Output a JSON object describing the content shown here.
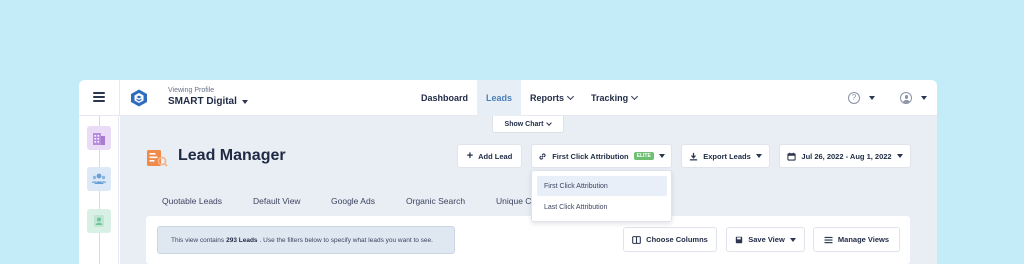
{
  "header": {
    "profile_label": "Viewing Profile",
    "profile_name": "SMART Digital",
    "nav": [
      {
        "label": "Dashboard",
        "active": false,
        "has_menu": false
      },
      {
        "label": "Leads",
        "active": true,
        "has_menu": false
      },
      {
        "label": "Reports",
        "active": false,
        "has_menu": true
      },
      {
        "label": "Tracking",
        "active": false,
        "has_menu": true
      }
    ],
    "help_glyph": "?"
  },
  "rail": {
    "items": [
      {
        "icon": "building-icon",
        "color": "#b98be0"
      },
      {
        "icon": "users-icon",
        "color": "#6a9fd8"
      },
      {
        "icon": "contact-card-icon",
        "color": "#6cc49a"
      }
    ]
  },
  "toolbar": {
    "show_chart": "Show Chart",
    "title": "Lead Manager",
    "add_lead": "Add Lead",
    "attribution": "First Click Attribution",
    "elite_badge": "ELITE",
    "export": "Export Leads",
    "date_range": "Jul 26, 2022 - Aug 1, 2022"
  },
  "tabs": [
    "Quotable Leads",
    "Default View",
    "Google Ads",
    "Organic Search",
    "Unique C"
  ],
  "notice": {
    "prefix": "This view contains",
    "count": "293 Leads",
    "suffix": ". Use the filters below to specify what leads you want to see."
  },
  "actions": {
    "choose_columns": "Choose Columns",
    "save_view": "Save View",
    "manage_views": "Manage Views"
  },
  "attribution_menu": {
    "options": [
      "First Click Attribution",
      "Last Click Attribution"
    ],
    "selected": "First Click Attribution"
  },
  "colors": {
    "background": "#c4ecf8",
    "accent": "#4a7fb8",
    "logo": "#2f6cc0",
    "elite": "#6fbf73",
    "lead_icon": "#f08a4b"
  }
}
